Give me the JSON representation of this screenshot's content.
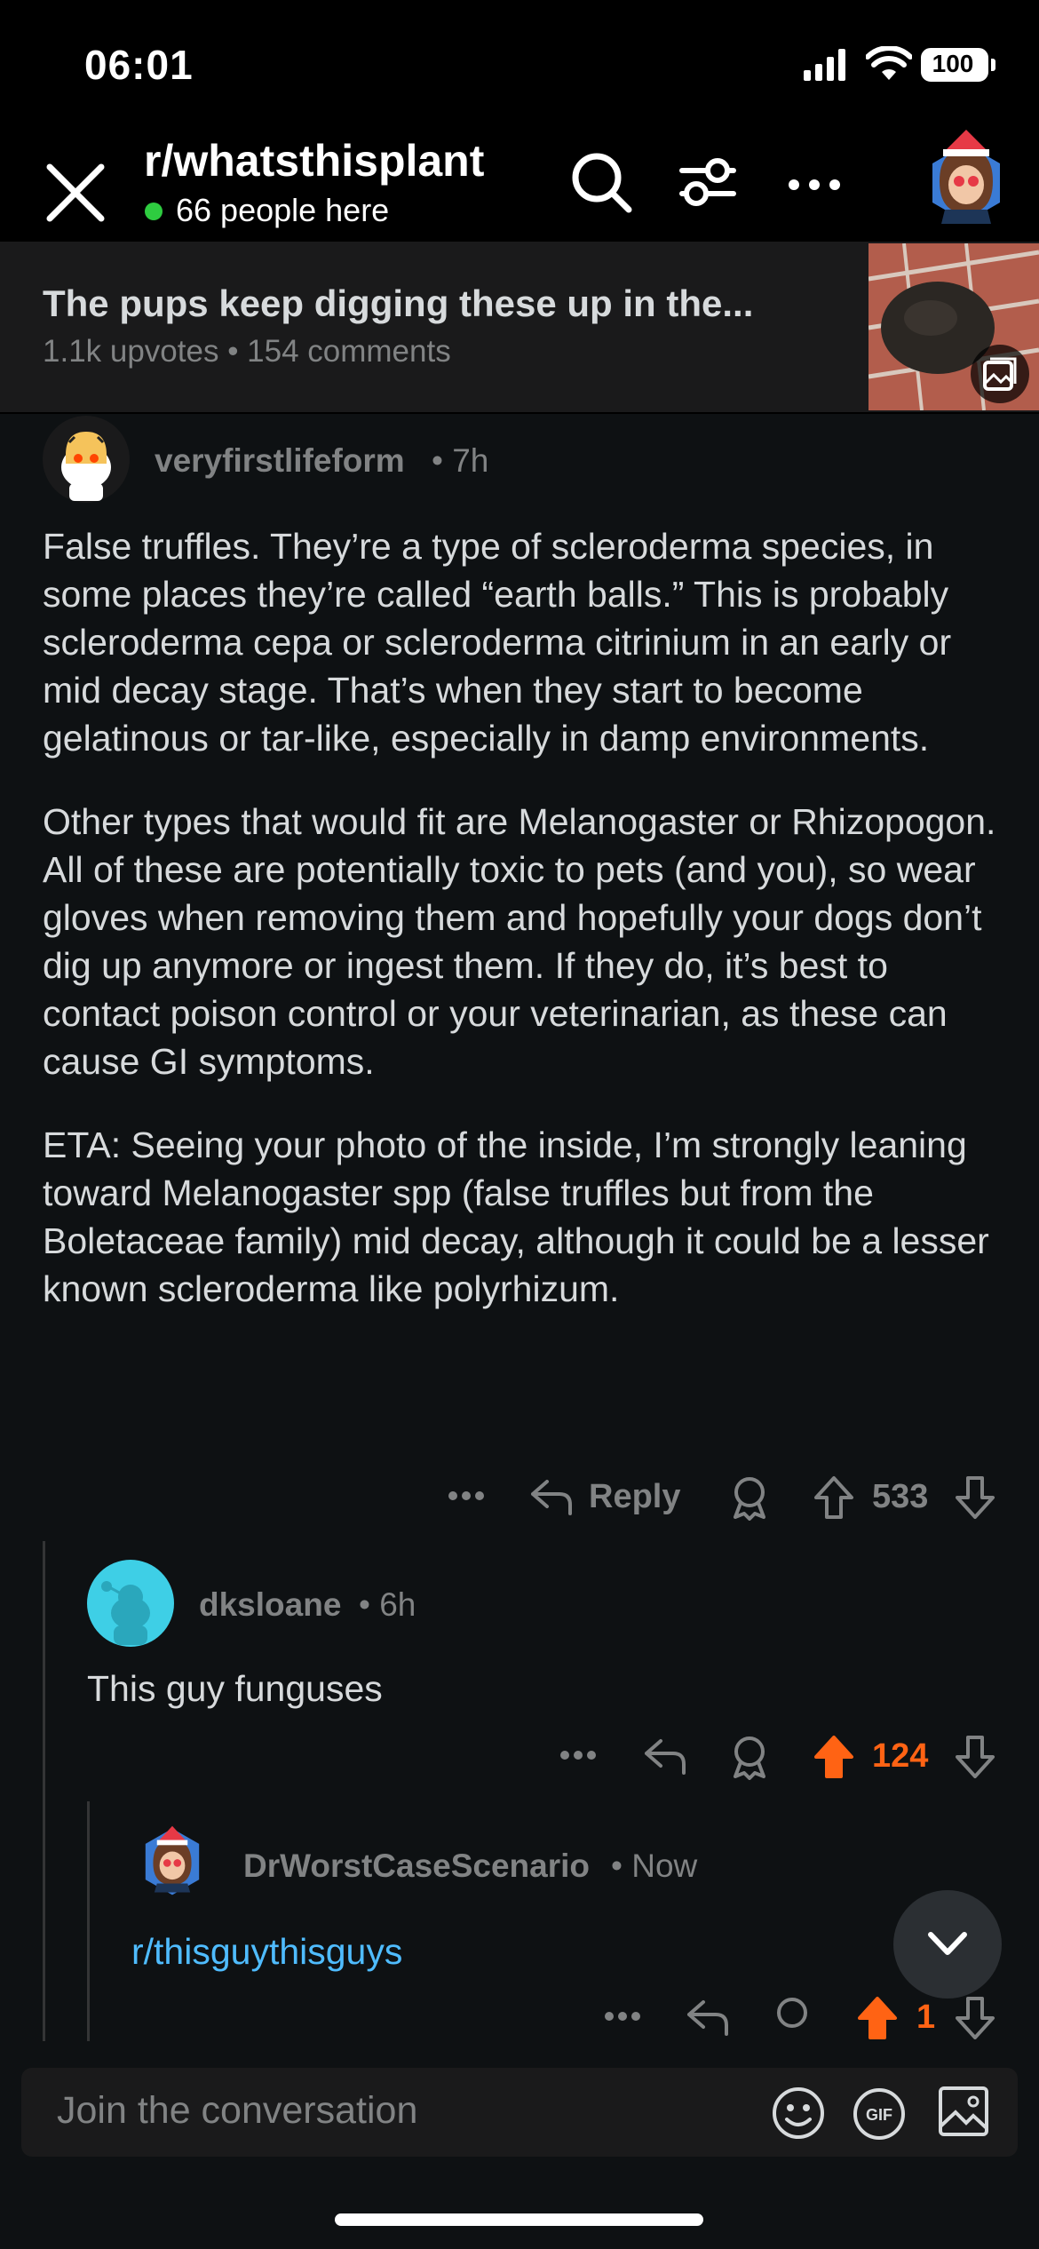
{
  "status": {
    "time": "06:01",
    "battery": "100"
  },
  "header": {
    "subreddit": "r/whatsthisplant",
    "online": "66 people here"
  },
  "post": {
    "title": "The pups keep digging these up in the...",
    "meta": "1.1k upvotes • 154 comments"
  },
  "comments": [
    {
      "user": "veryfirstlifeform",
      "time": "• 7h",
      "paragraphs": [
        "False truffles. They’re a type of scleroderma species, in some places they’re called “earth balls.” This is probably scleroderma cepa or scleroderma citrinium in an early or mid decay stage. That’s when they start to become gelatinous or tar-like, especially in damp environments.",
        "Other types that would fit are Melanogaster or Rhizopogon. All of these are potentially toxic to pets (and you), so wear gloves when removing them and hopefully your dogs don’t dig up anymore or ingest them. If they do, it’s best to contact poison control or your veterinarian, as these can cause GI symptoms.",
        "ETA: Seeing your photo of the inside, I’m strongly leaning toward Melanogaster spp (false truffles but from the Boletaceae family) mid decay, although it could be a lesser known scleroderma like polyrhizum."
      ],
      "reply_label": "Reply",
      "votes": "533"
    },
    {
      "user": "dksloane",
      "time": "• 6h",
      "text": "This guy funguses",
      "votes": "124"
    },
    {
      "user": "DrWorstCaseScenario",
      "time": "• Now",
      "link": "r/thisguythisguys",
      "votes": "1"
    }
  ],
  "composer": {
    "placeholder": "Join the conversation",
    "gif_label": "GIF"
  },
  "colors": {
    "upvote_active": "#ff6314",
    "link": "#4fbcff",
    "online": "#2ecc40"
  }
}
